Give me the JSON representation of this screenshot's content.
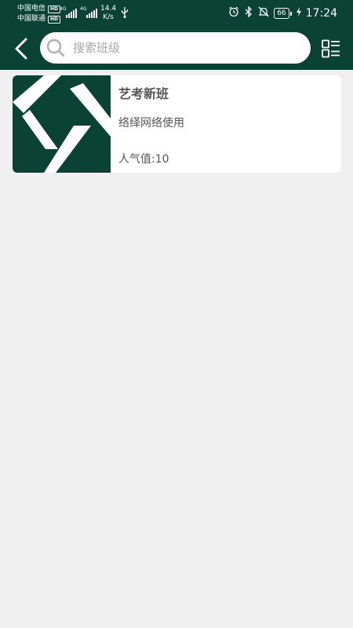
{
  "status_bar": {
    "carrier1": "中国电信",
    "carrier2": "中国联通",
    "hd_badge": "HD",
    "net_type": "4G",
    "speed_value": "14.4",
    "speed_unit": "K/s",
    "battery_level": "66",
    "time": "17:24",
    "icons": [
      "usb-icon",
      "alarm-icon",
      "bluetooth-icon",
      "mute-icon",
      "battery-icon",
      "charging-icon"
    ]
  },
  "header": {
    "back_icon": "chevron-left-icon",
    "search_icon": "search-icon",
    "search_placeholder": "搜索班级",
    "search_value": "",
    "menu_icon": "list-view-icon"
  },
  "classes": [
    {
      "title": "艺考新班",
      "description": "络绎网络使用",
      "popularity": "人气值:10",
      "thumb_icon": "class-logo-icon"
    }
  ],
  "colors": {
    "header_bg": "#0a4333",
    "page_bg": "#f1f0f1",
    "card_bg": "#ffffff",
    "text": "#555555",
    "placeholder": "#a6a6a6"
  }
}
